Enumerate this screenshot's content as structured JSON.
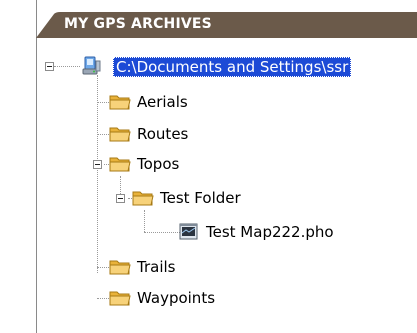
{
  "panel": {
    "title": "MY GPS ARCHIVES"
  },
  "tree": {
    "root": {
      "label": "C:\\Documents and Settings\\ssr",
      "icon": "computer-drive-icon",
      "expanded": true,
      "selected": true
    },
    "items": [
      {
        "label": "Aerials",
        "icon": "folder-icon"
      },
      {
        "label": "Routes",
        "icon": "folder-icon"
      },
      {
        "label": "Topos",
        "icon": "folder-icon",
        "expanded": true
      },
      {
        "label": "Test Folder",
        "icon": "folder-icon",
        "expanded": true
      },
      {
        "label": "Test Map222.pho",
        "icon": "map-file-icon"
      },
      {
        "label": "Trails",
        "icon": "folder-icon"
      },
      {
        "label": "Waypoints",
        "icon": "folder-icon"
      }
    ]
  },
  "colors": {
    "header_bg": "#6b5a4a",
    "selection": "#1c4ad6",
    "folder": "#f2c14e"
  }
}
